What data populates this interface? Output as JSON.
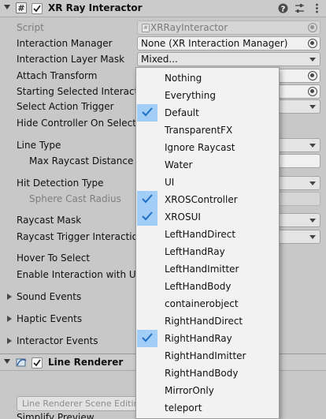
{
  "component1": {
    "title": "XR Ray Interactor",
    "enabled": true,
    "icons": {
      "component_icon": "hash-script-icon",
      "help": "help-icon",
      "presets": "sliders-icon",
      "menu": "kebab-menu-icon"
    }
  },
  "fields": {
    "script": {
      "label": "Script",
      "value": "XRRayInteractor"
    },
    "interaction_manager": {
      "label": "Interaction Manager",
      "value": "None (XR Interaction Manager)"
    },
    "interaction_layer_mask": {
      "label": "Interaction Layer Mask",
      "value": "Mixed..."
    },
    "attach_transform": {
      "label": "Attach Transform"
    },
    "starting_selected": {
      "label": "Starting Selected Interacta"
    },
    "select_action_trigger": {
      "label": "Select Action Trigger"
    },
    "hide_controller": {
      "label": "Hide Controller On Select"
    },
    "line_type": {
      "label": "Line Type"
    },
    "max_raycast_distance": {
      "label": "Max Raycast Distance"
    },
    "hit_detection_type": {
      "label": "Hit Detection Type"
    },
    "sphere_cast_radius": {
      "label": "Sphere Cast Radius"
    },
    "raycast_mask": {
      "label": "Raycast Mask"
    },
    "raycast_trigger": {
      "label": "Raycast Trigger Interaction"
    },
    "hover_to_select": {
      "label": "Hover To Select"
    },
    "enable_ui": {
      "label": "Enable Interaction with UI G"
    }
  },
  "foldouts": [
    "Sound Events",
    "Haptic Events",
    "Interactor Events"
  ],
  "component2": {
    "title": "Line Renderer",
    "enabled": true,
    "scene_editing_button": "Line Renderer Scene Editing M",
    "simplify_label": "Simplify Preview"
  },
  "layer_menu": {
    "items": [
      {
        "label": "Nothing",
        "checked": false
      },
      {
        "label": "Everything",
        "checked": false
      },
      {
        "label": "Default",
        "checked": true
      },
      {
        "label": "TransparentFX",
        "checked": false
      },
      {
        "label": "Ignore Raycast",
        "checked": false
      },
      {
        "label": "Water",
        "checked": false
      },
      {
        "label": "UI",
        "checked": false
      },
      {
        "label": "XROSController",
        "checked": true
      },
      {
        "label": "XROSUI",
        "checked": true
      },
      {
        "label": "LeftHandDirect",
        "checked": false
      },
      {
        "label": "LeftHandRay",
        "checked": false
      },
      {
        "label": "LeftHandImitter",
        "checked": false
      },
      {
        "label": "LeftHandBody",
        "checked": false
      },
      {
        "label": "containerobject",
        "checked": false
      },
      {
        "label": "RightHandDirect",
        "checked": false
      },
      {
        "label": "RightHandRay",
        "checked": true
      },
      {
        "label": "RightHandImitter",
        "checked": false
      },
      {
        "label": "RightHandBody",
        "checked": false
      },
      {
        "label": "MirrorOnly",
        "checked": false
      },
      {
        "label": "teleport",
        "checked": false
      }
    ]
  },
  "colors": {
    "check_highlight": "#a2cdf6",
    "panel": "#c8c8c8",
    "menu_bg": "#f2f2f2"
  }
}
